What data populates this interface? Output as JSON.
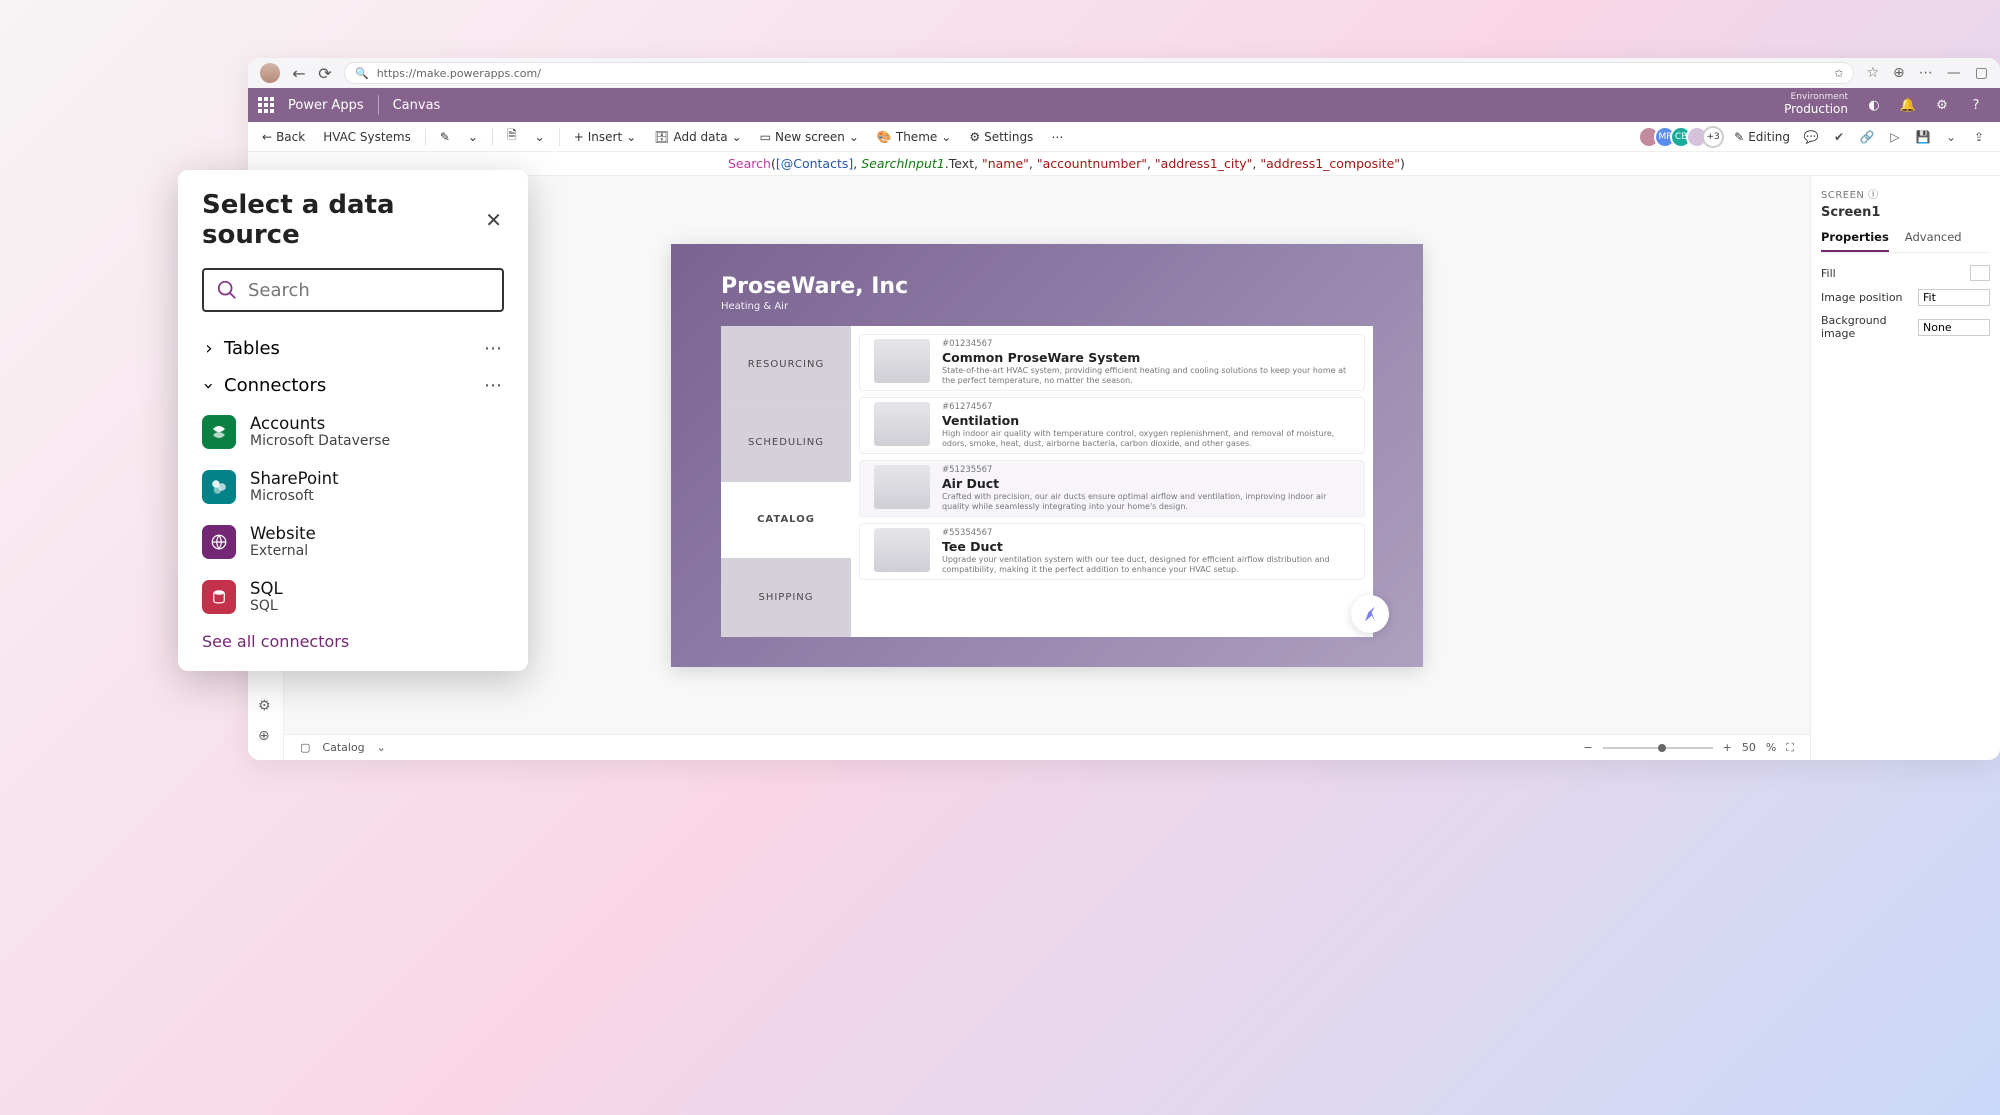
{
  "browser": {
    "url": "https://make.powerapps.com/"
  },
  "header": {
    "app_name": "Power Apps",
    "context": "Canvas",
    "env_label": "Environment",
    "env_value": "Production"
  },
  "cmdbar": {
    "back": "Back",
    "file_name": "HVAC Systems",
    "insert": "Insert",
    "add_data": "Add data",
    "new_screen": "New screen",
    "theme": "Theme",
    "settings": "Settings",
    "editing": "Editing",
    "presence_more": "+3"
  },
  "formula": {
    "fn": "Search",
    "ref": "[@Contacts]",
    "input": "SearchInput1",
    "prop": ".Text",
    "args": [
      "\"name\"",
      "\"accountnumber\"",
      "\"address1_city\"",
      "\"address1_composite\""
    ]
  },
  "canvas": {
    "company": "ProseWare, Inc",
    "subtitle": "Heating & Air",
    "tabs": [
      "RESOURCING",
      "SCHEDULING",
      "CATALOG",
      "SHIPPING"
    ],
    "active_tab_index": 2,
    "items": [
      {
        "sku": "#01234567",
        "name": "Common ProseWare System",
        "desc": "State-of-the-art HVAC system, providing efficient heating and cooling solutions to keep your home at the perfect temperature, no matter the season."
      },
      {
        "sku": "#61274567",
        "name": "Ventilation",
        "desc": "High indoor air quality with temperature control, oxygen replenishment, and removal of moisture, odors, smoke, heat, dust, airborne bacteria, carbon dioxide, and other gases."
      },
      {
        "sku": "#51235567",
        "name": "Air Duct",
        "desc": "Crafted with precision, our air ducts ensure optimal airflow and ventilation, improving indoor air quality while seamlessly integrating into your home's design."
      },
      {
        "sku": "#55354567",
        "name": "Tee Duct",
        "desc": "Upgrade your ventilation system with our tee duct, designed for efficient airflow distribution and compatibility, making it the perfect addition to enhance your HVAC setup."
      }
    ]
  },
  "props": {
    "section_label": "SCREEN",
    "screen_name": "Screen1",
    "tab_properties": "Properties",
    "tab_advanced": "Advanced",
    "fill_label": "Fill",
    "image_position_label": "Image position",
    "image_position_value": "Fit",
    "bg_image_label": "Background image",
    "bg_image_value": "None"
  },
  "status": {
    "label": "Catalog",
    "zoom_value": "50",
    "zoom_unit": "%"
  },
  "modal": {
    "title": "Select a data source",
    "search_placeholder": "Search",
    "group_tables": "Tables",
    "group_connectors": "Connectors",
    "connectors": [
      {
        "title": "Accounts",
        "subtitle": "Microsoft Dataverse",
        "color": "green"
      },
      {
        "title": "SharePoint",
        "subtitle": "Microsoft",
        "color": "teal"
      },
      {
        "title": "Website",
        "subtitle": "External",
        "color": "purple"
      },
      {
        "title": "SQL",
        "subtitle": "SQL",
        "color": "red"
      }
    ],
    "see_all": "See all connectors"
  }
}
